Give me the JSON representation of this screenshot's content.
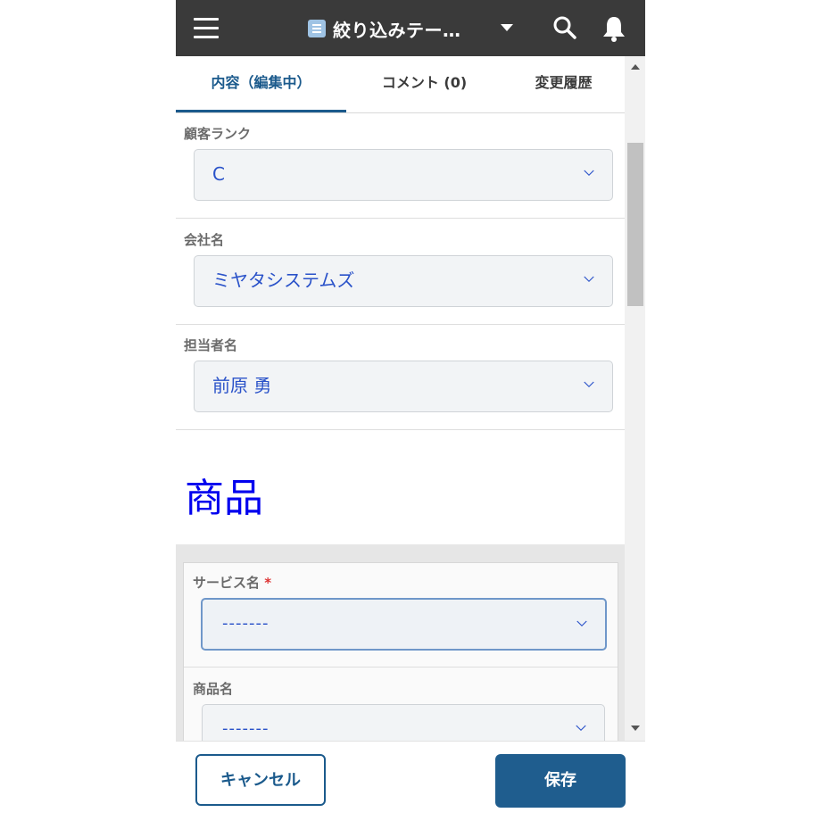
{
  "header": {
    "title": "絞り込みテー…",
    "icons": [
      "menu-icon",
      "list-icon",
      "dropdown-caret-icon",
      "search-icon",
      "bell-icon"
    ]
  },
  "tabs": [
    {
      "label": "内容（編集中）",
      "active": true
    },
    {
      "label": "コメント (0)",
      "active": false
    },
    {
      "label": "変更履歴",
      "active": false
    }
  ],
  "fields": {
    "customer_rank": {
      "label": "顧客ランク",
      "value": "C"
    },
    "company_name": {
      "label": "会社名",
      "value": "ミヤタシステムズ"
    },
    "contact_name": {
      "label": "担当者名",
      "value": "前原 勇"
    }
  },
  "section": {
    "title": "商品"
  },
  "product_fields": {
    "service_name": {
      "label": "サービス名",
      "required_mark": "*",
      "value": "-------"
    },
    "product_name": {
      "label": "商品名",
      "value": "-------"
    }
  },
  "footer": {
    "cancel_label": "キャンセル",
    "save_label": "保存"
  },
  "colors": {
    "header_bg": "#3a3a3a",
    "accent": "#1b5a8c",
    "value_text": "#2a52c9",
    "section_title": "#0000ee"
  }
}
